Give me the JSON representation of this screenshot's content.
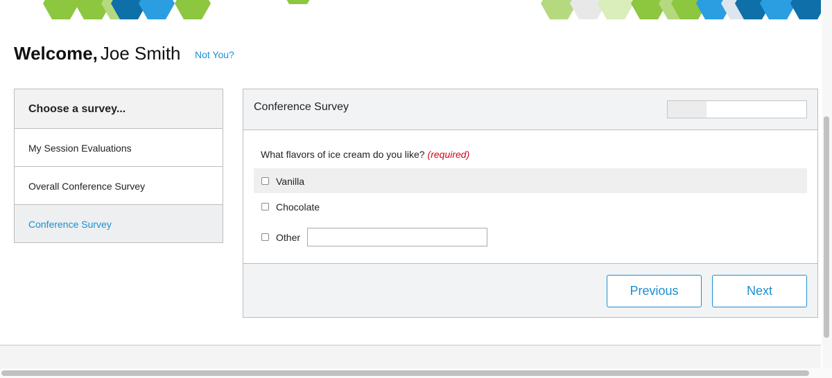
{
  "header": {
    "welcome_bold": "Welcome,",
    "user_name": "Joe Smith",
    "not_you_link": "Not You?",
    "accent_colors": [
      "#8dc63f",
      "#b5d97f",
      "#0f6fa8",
      "#2a9ee0",
      "#dde6ef"
    ]
  },
  "sidebar": {
    "heading": "Choose a survey...",
    "items": [
      {
        "label": "My Session Evaluations"
      },
      {
        "label": "Overall Conference Survey"
      },
      {
        "label": "Conference Survey"
      }
    ]
  },
  "survey": {
    "title": "Conference Survey",
    "progress_fraction": 0.28,
    "question": {
      "text": "What flavors of ice cream do you like?",
      "required_label": "(required)",
      "options": [
        {
          "label": "Vanilla",
          "checked": false
        },
        {
          "label": "Chocolate",
          "checked": false
        },
        {
          "label": "Other",
          "checked": false
        }
      ],
      "other_value": ""
    },
    "buttons": {
      "previous_label": "Previous",
      "next_label": "Next"
    }
  }
}
